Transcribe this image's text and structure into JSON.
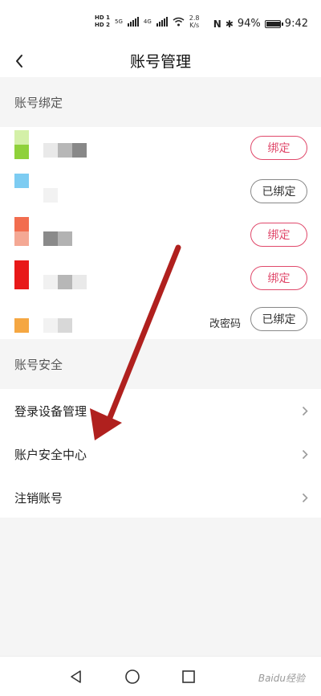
{
  "status_bar": {
    "hd1": "HD 1",
    "hd2": "HD 2",
    "net1": "5G",
    "net2": "4G",
    "speed_value": "2.8",
    "speed_unit": "K/s",
    "nfc": "N",
    "bluetooth": "✱",
    "battery_pct": "94%",
    "battery_level": 0.94,
    "time": "9:42"
  },
  "nav": {
    "back_icon": "chevron-left-icon",
    "title": "账号管理"
  },
  "binding_section": {
    "header": "账号绑定",
    "rows": [
      {
        "icon_colors": [
          "#d4f0a8",
          "#8fd13a"
        ],
        "name_blur": [
          "#e9e9e9",
          "#b7b7b7",
          "#888888"
        ],
        "button": "绑定",
        "status": "unbound"
      },
      {
        "icon_colors": [
          "#7dccf2"
        ],
        "name_blur": [
          "#f2f2f2"
        ],
        "button": "已绑定",
        "status": "bound"
      },
      {
        "icon_colors": [
          "#f26d4f",
          "#f4a894"
        ],
        "name_blur": [
          "#8a8a8a",
          "#b2b2b2"
        ],
        "button": "绑定",
        "status": "unbound"
      },
      {
        "icon_colors": [
          "#e81919",
          "#e81919"
        ],
        "name_blur": [
          "#f1f1f1",
          "#b7b7b7",
          "#e9e9e9"
        ],
        "button": "绑定",
        "status": "unbound"
      },
      {
        "icon_colors": [
          "#f5a742"
        ],
        "name_blur": [
          "#f2f2f2",
          "#d8d8d8"
        ],
        "partial_text": "改密码",
        "button": "已绑定",
        "status": "bound"
      }
    ]
  },
  "security_section": {
    "header": "账号安全",
    "items": [
      {
        "label": "登录设备管理",
        "icon": "chevron-right-icon"
      },
      {
        "label": "账户安全中心",
        "icon": "chevron-right-icon"
      },
      {
        "label": "注销账号",
        "icon": "chevron-right-icon"
      }
    ]
  },
  "annotation": {
    "arrow_color": "#b0201e"
  },
  "system_nav": {
    "back": "triangle-back-icon",
    "home": "circle-home-icon",
    "recents": "square-recents-icon"
  },
  "watermark": "Baidu经验"
}
